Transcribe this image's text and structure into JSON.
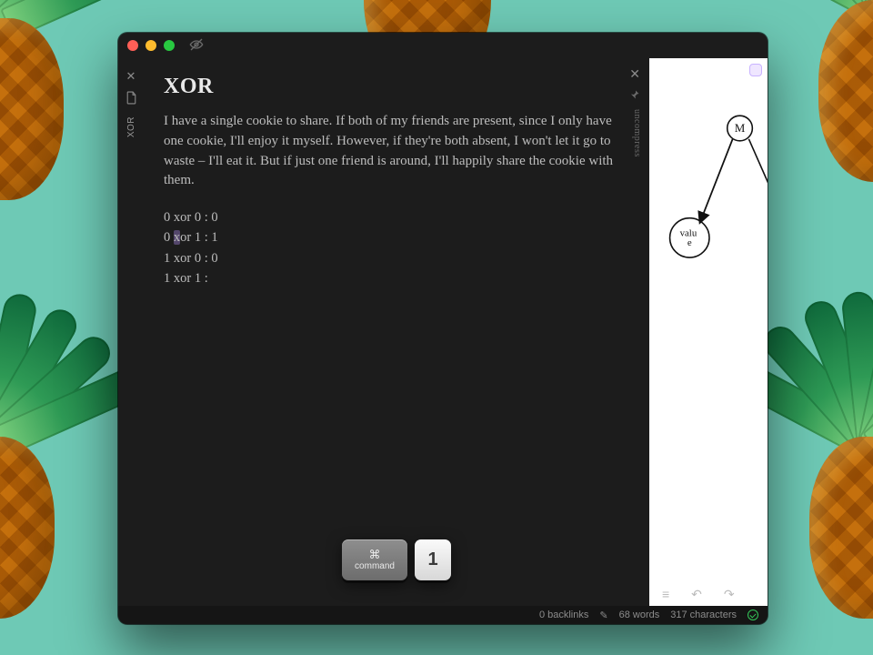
{
  "sidebar": {
    "tab_label": "XOR"
  },
  "panel": {
    "side_label": "uncompress"
  },
  "note": {
    "title": "XOR",
    "body": "I have a single cookie to share. If both of my friends are present, since I only have one cookie, I'll enjoy it myself. However, if they're both absent, I won't let it go to waste – I'll eat it. But if just one friend is around, I'll happily share the cookie with them.",
    "truth_rows": [
      {
        "pre": "0 xor 0 : 0",
        "hl": "",
        "post": ""
      },
      {
        "pre": "0 ",
        "hl": "x",
        "post": "or 1 : 1"
      },
      {
        "pre": "1 xor 0 : 0",
        "hl": "",
        "post": ""
      },
      {
        "pre": "1 xor 1 :",
        "hl": "",
        "post": ""
      }
    ]
  },
  "hint": {
    "modifier_glyph": "⌘",
    "modifier_label": "command",
    "key": "1"
  },
  "canvas": {
    "node_top": "M",
    "node_bottom": "value",
    "toolbar": {
      "menu": "≡",
      "undo": "↶",
      "redo": "↷"
    }
  },
  "status": {
    "backlinks": "0 backlinks",
    "words": "68 words",
    "chars": "317 characters"
  }
}
